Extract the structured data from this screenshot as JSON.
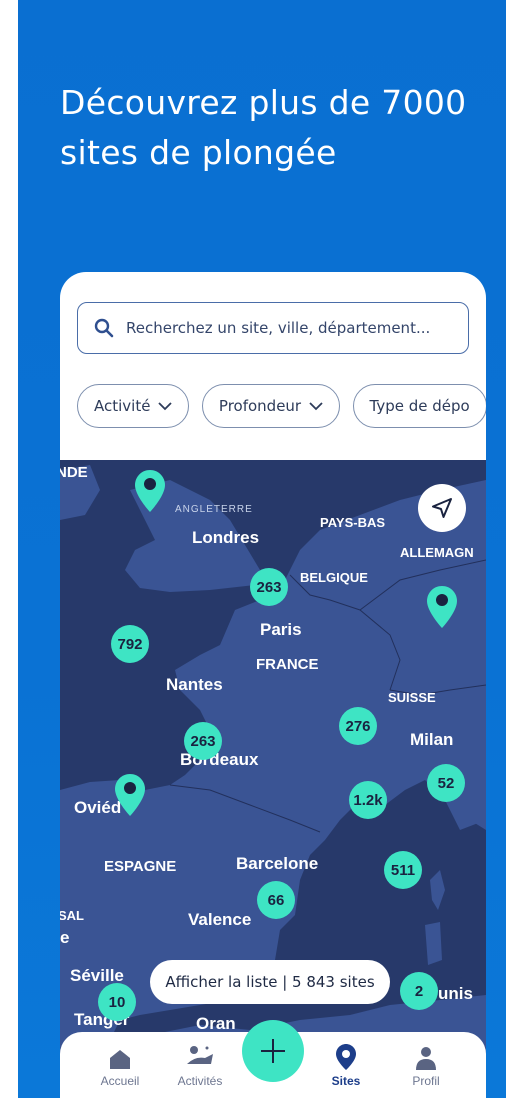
{
  "headline": {
    "line1": "Découvrez plus de 7000",
    "line2": "sites de plongée"
  },
  "search": {
    "placeholder": "Recherchez un site, ville, département..."
  },
  "filters": [
    {
      "label": "Activité"
    },
    {
      "label": "Profondeur"
    },
    {
      "label": "Type de dépo"
    }
  ],
  "map": {
    "labels": {
      "irlande": "NDE",
      "angleterre": "ANGLETERRE",
      "londres": "Londres",
      "paysbas": "PAYS-BAS",
      "allemagne": "ALLEMAGN",
      "belgique": "BELGIQUE",
      "paris": "Paris",
      "france": "FRANCE",
      "nantes": "Nantes",
      "suisse": "SUISSE",
      "milan": "Milan",
      "bordeaux": "Bordeaux",
      "oviedo": "Oviéd",
      "espagne": "ESPAGNE",
      "barcelone": "Barcelone",
      "portugal": "SAL",
      "valence": "Valence",
      "seville": "Séville",
      "tanger": "Tanger",
      "oran": "Oran",
      "tunis": "unis",
      "e": "e"
    },
    "clusters": {
      "c263a": "263",
      "c792": "792",
      "c263b": "263",
      "c276": "276",
      "c52": "52",
      "c12k": "1.2k",
      "c511": "511",
      "c66": "66",
      "c2": "2",
      "c10": "10"
    },
    "list_button": "Afficher la liste | 5 843 sites"
  },
  "tabbar": {
    "home": "Accueil",
    "activities": "Activités",
    "sites": "Sites",
    "profile": "Profil"
  },
  "colors": {
    "brand_blue": "#0a6fd1",
    "accent": "#3ee4c4",
    "map": "#27396a"
  }
}
